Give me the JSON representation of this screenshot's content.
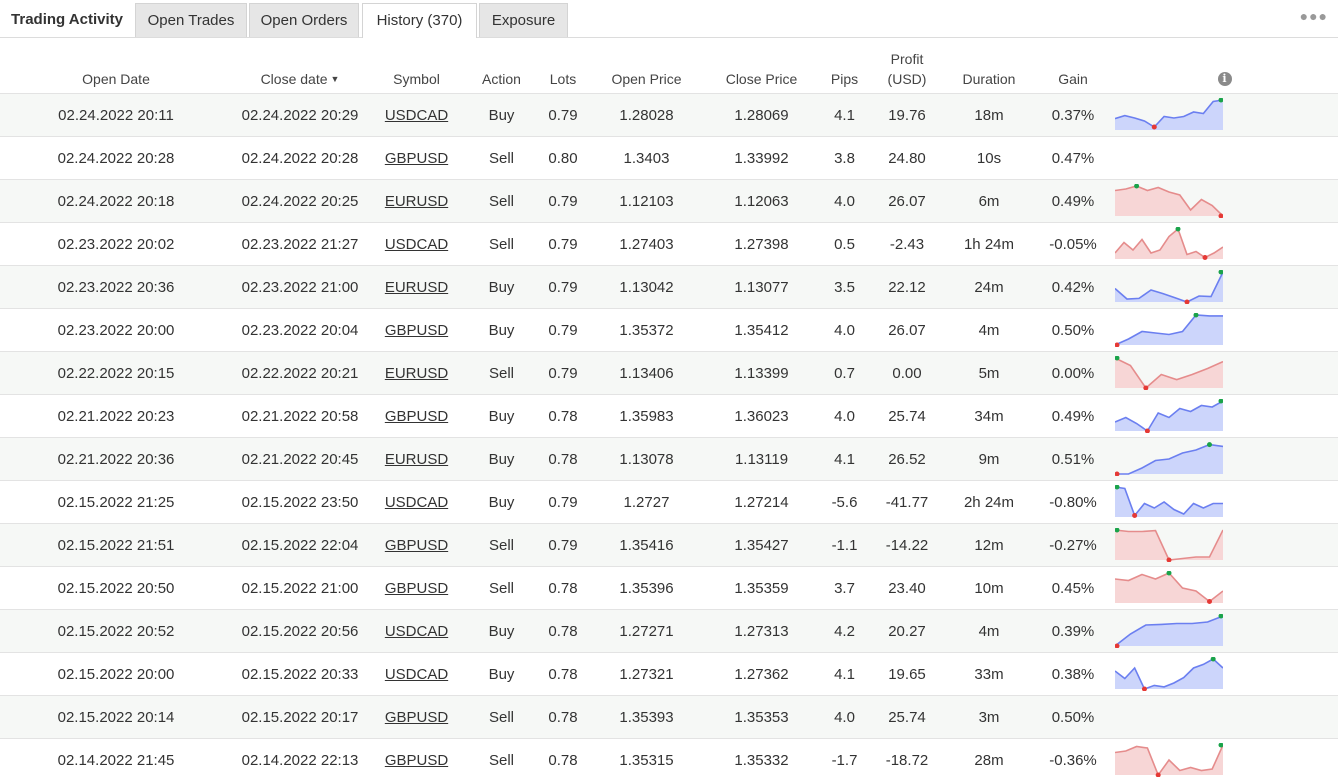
{
  "tabs": {
    "title": "Trading Activity",
    "items": [
      "Open Trades",
      "Open Orders",
      "History (370)",
      "Exposure"
    ],
    "active": 2
  },
  "more_icon": "more-dots-icon",
  "columns": {
    "open_date": "Open Date",
    "close_date": "Close date",
    "symbol": "Symbol",
    "action": "Action",
    "lots": "Lots",
    "open_price": "Open Price",
    "close_price": "Close Price",
    "pips": "Pips",
    "profit_l1": "Profit",
    "profit_l2": "(USD)",
    "duration": "Duration",
    "gain": "Gain",
    "info_icon": "info-icon"
  },
  "colors": {
    "positive": "#1aa34a",
    "negative": "#e53935",
    "spark_up_line": "#6b7ff0",
    "spark_up_fill": "#ccd5fb",
    "spark_down_line": "#e58c8c",
    "spark_down_fill": "#f7d6d6"
  },
  "rows": [
    {
      "open": "02.24.2022 20:11",
      "close": "02.24.2022 20:29",
      "symbol": "USDCAD",
      "action": "Buy",
      "lots": "0.79",
      "open_price": "1.28028",
      "close_price": "1.28069",
      "pips": "4.1",
      "profit": "19.76",
      "duration": "18m",
      "gain": "0.37%",
      "trend": "up",
      "spark": [
        0.62,
        0.52,
        0.6,
        0.7,
        0.9,
        0.55,
        0.6,
        0.55,
        0.4,
        0.45,
        0.05,
        0.0
      ]
    },
    {
      "open": "02.24.2022 20:28",
      "close": "02.24.2022 20:28",
      "symbol": "GBPUSD",
      "action": "Sell",
      "lots": "0.80",
      "open_price": "1.3403",
      "close_price": "1.33992",
      "pips": "3.8",
      "profit": "24.80",
      "duration": "10s",
      "gain": "0.47%",
      "trend": "none",
      "spark": []
    },
    {
      "open": "02.24.2022 20:18",
      "close": "02.24.2022 20:25",
      "symbol": "EURUSD",
      "action": "Sell",
      "lots": "0.79",
      "open_price": "1.12103",
      "close_price": "1.12063",
      "pips": "4.0",
      "profit": "26.07",
      "duration": "6m",
      "gain": "0.49%",
      "trend": "down",
      "spark": [
        0.15,
        0.1,
        0.0,
        0.15,
        0.05,
        0.2,
        0.3,
        0.8,
        0.45,
        0.65,
        1.0
      ]
    },
    {
      "open": "02.23.2022 20:02",
      "close": "02.23.2022 21:27",
      "symbol": "USDCAD",
      "action": "Sell",
      "lots": "0.79",
      "open_price": "1.27403",
      "close_price": "1.27398",
      "pips": "0.5",
      "profit": "-2.43",
      "duration": "1h 24m",
      "gain": "-0.05%",
      "trend": "down",
      "spark": [
        0.8,
        0.45,
        0.7,
        0.35,
        0.8,
        0.7,
        0.25,
        0.0,
        0.85,
        0.75,
        0.95,
        0.8,
        0.6
      ]
    },
    {
      "open": "02.23.2022 20:36",
      "close": "02.23.2022 21:00",
      "symbol": "EURUSD",
      "action": "Buy",
      "lots": "0.79",
      "open_price": "1.13042",
      "close_price": "1.13077",
      "pips": "3.5",
      "profit": "22.12",
      "duration": "24m",
      "gain": "0.42%",
      "trend": "up",
      "spark": [
        0.55,
        0.9,
        0.88,
        0.6,
        0.72,
        0.86,
        1.0,
        0.8,
        0.82,
        0.0
      ]
    },
    {
      "open": "02.23.2022 20:00",
      "close": "02.23.2022 20:04",
      "symbol": "GBPUSD",
      "action": "Buy",
      "lots": "0.79",
      "open_price": "1.35372",
      "close_price": "1.35412",
      "pips": "4.0",
      "profit": "26.07",
      "duration": "4m",
      "gain": "0.50%",
      "trend": "up",
      "spark": [
        1.0,
        0.8,
        0.55,
        0.6,
        0.65,
        0.55,
        0.0,
        0.03,
        0.03
      ]
    },
    {
      "open": "02.22.2022 20:15",
      "close": "02.22.2022 20:21",
      "symbol": "EURUSD",
      "action": "Sell",
      "lots": "0.79",
      "open_price": "1.13406",
      "close_price": "1.13399",
      "pips": "0.7",
      "profit": "0.00",
      "duration": "5m",
      "gain": "0.00%",
      "trend": "down",
      "spark": [
        0.0,
        0.25,
        1.0,
        0.55,
        0.72,
        0.55,
        0.35,
        0.12
      ]
    },
    {
      "open": "02.21.2022 20:23",
      "close": "02.21.2022 20:58",
      "symbol": "GBPUSD",
      "action": "Buy",
      "lots": "0.78",
      "open_price": "1.35983",
      "close_price": "1.36023",
      "pips": "4.0",
      "profit": "25.74",
      "duration": "34m",
      "gain": "0.49%",
      "trend": "up",
      "spark": [
        0.7,
        0.55,
        0.75,
        1.0,
        0.4,
        0.55,
        0.25,
        0.35,
        0.15,
        0.2,
        0.0
      ]
    },
    {
      "open": "02.21.2022 20:36",
      "close": "02.21.2022 20:45",
      "symbol": "EURUSD",
      "action": "Buy",
      "lots": "0.78",
      "open_price": "1.13078",
      "close_price": "1.13119",
      "pips": "4.1",
      "profit": "26.52",
      "duration": "9m",
      "gain": "0.51%",
      "trend": "up",
      "spark": [
        1.0,
        1.0,
        0.8,
        0.55,
        0.5,
        0.3,
        0.2,
        0.02,
        0.08
      ]
    },
    {
      "open": "02.15.2022 21:25",
      "close": "02.15.2022 23:50",
      "symbol": "USDCAD",
      "action": "Buy",
      "lots": "0.79",
      "open_price": "1.2727",
      "close_price": "1.27214",
      "pips": "-5.6",
      "profit": "-41.77",
      "duration": "2h 24m",
      "gain": "-0.80%",
      "trend": "up",
      "spark": [
        0.0,
        0.05,
        0.95,
        0.55,
        0.7,
        0.5,
        0.75,
        0.9,
        0.55,
        0.7,
        0.55,
        0.55
      ]
    },
    {
      "open": "02.15.2022 21:51",
      "close": "02.15.2022 22:04",
      "symbol": "GBPUSD",
      "action": "Sell",
      "lots": "0.79",
      "open_price": "1.35416",
      "close_price": "1.35427",
      "pips": "-1.1",
      "profit": "-14.22",
      "duration": "12m",
      "gain": "-0.27%",
      "trend": "down",
      "spark": [
        0.0,
        0.05,
        0.05,
        0.02,
        1.0,
        0.95,
        0.9,
        0.9,
        0.0
      ]
    },
    {
      "open": "02.15.2022 20:50",
      "close": "02.15.2022 21:00",
      "symbol": "GBPUSD",
      "action": "Sell",
      "lots": "0.78",
      "open_price": "1.35396",
      "close_price": "1.35359",
      "pips": "3.7",
      "profit": "23.40",
      "duration": "10m",
      "gain": "0.45%",
      "trend": "down",
      "spark": [
        0.2,
        0.25,
        0.05,
        0.2,
        0.0,
        0.5,
        0.6,
        0.95,
        0.6
      ]
    },
    {
      "open": "02.15.2022 20:52",
      "close": "02.15.2022 20:56",
      "symbol": "USDCAD",
      "action": "Buy",
      "lots": "0.78",
      "open_price": "1.27271",
      "close_price": "1.27313",
      "pips": "4.2",
      "profit": "20.27",
      "duration": "4m",
      "gain": "0.39%",
      "trend": "up",
      "spark": [
        1.0,
        0.6,
        0.3,
        0.28,
        0.25,
        0.25,
        0.2,
        0.0
      ]
    },
    {
      "open": "02.15.2022 20:00",
      "close": "02.15.2022 20:33",
      "symbol": "USDCAD",
      "action": "Buy",
      "lots": "0.78",
      "open_price": "1.27321",
      "close_price": "1.27362",
      "pips": "4.1",
      "profit": "19.65",
      "duration": "33m",
      "gain": "0.38%",
      "trend": "up",
      "spark": [
        0.4,
        0.65,
        0.3,
        1.0,
        0.88,
        0.93,
        0.8,
        0.62,
        0.3,
        0.18,
        0.0,
        0.3
      ]
    },
    {
      "open": "02.15.2022 20:14",
      "close": "02.15.2022 20:17",
      "symbol": "GBPUSD",
      "action": "Sell",
      "lots": "0.78",
      "open_price": "1.35393",
      "close_price": "1.35353",
      "pips": "4.0",
      "profit": "25.74",
      "duration": "3m",
      "gain": "0.50%",
      "trend": "none",
      "spark": []
    },
    {
      "open": "02.14.2022 21:45",
      "close": "02.14.2022 22:13",
      "symbol": "GBPUSD",
      "action": "Sell",
      "lots": "0.78",
      "open_price": "1.35315",
      "close_price": "1.35332",
      "pips": "-1.7",
      "profit": "-18.72",
      "duration": "28m",
      "gain": "-0.36%",
      "trend": "down",
      "spark": [
        0.25,
        0.2,
        0.05,
        0.1,
        1.0,
        0.5,
        0.85,
        0.75,
        0.85,
        0.8,
        0.0
      ]
    }
  ]
}
